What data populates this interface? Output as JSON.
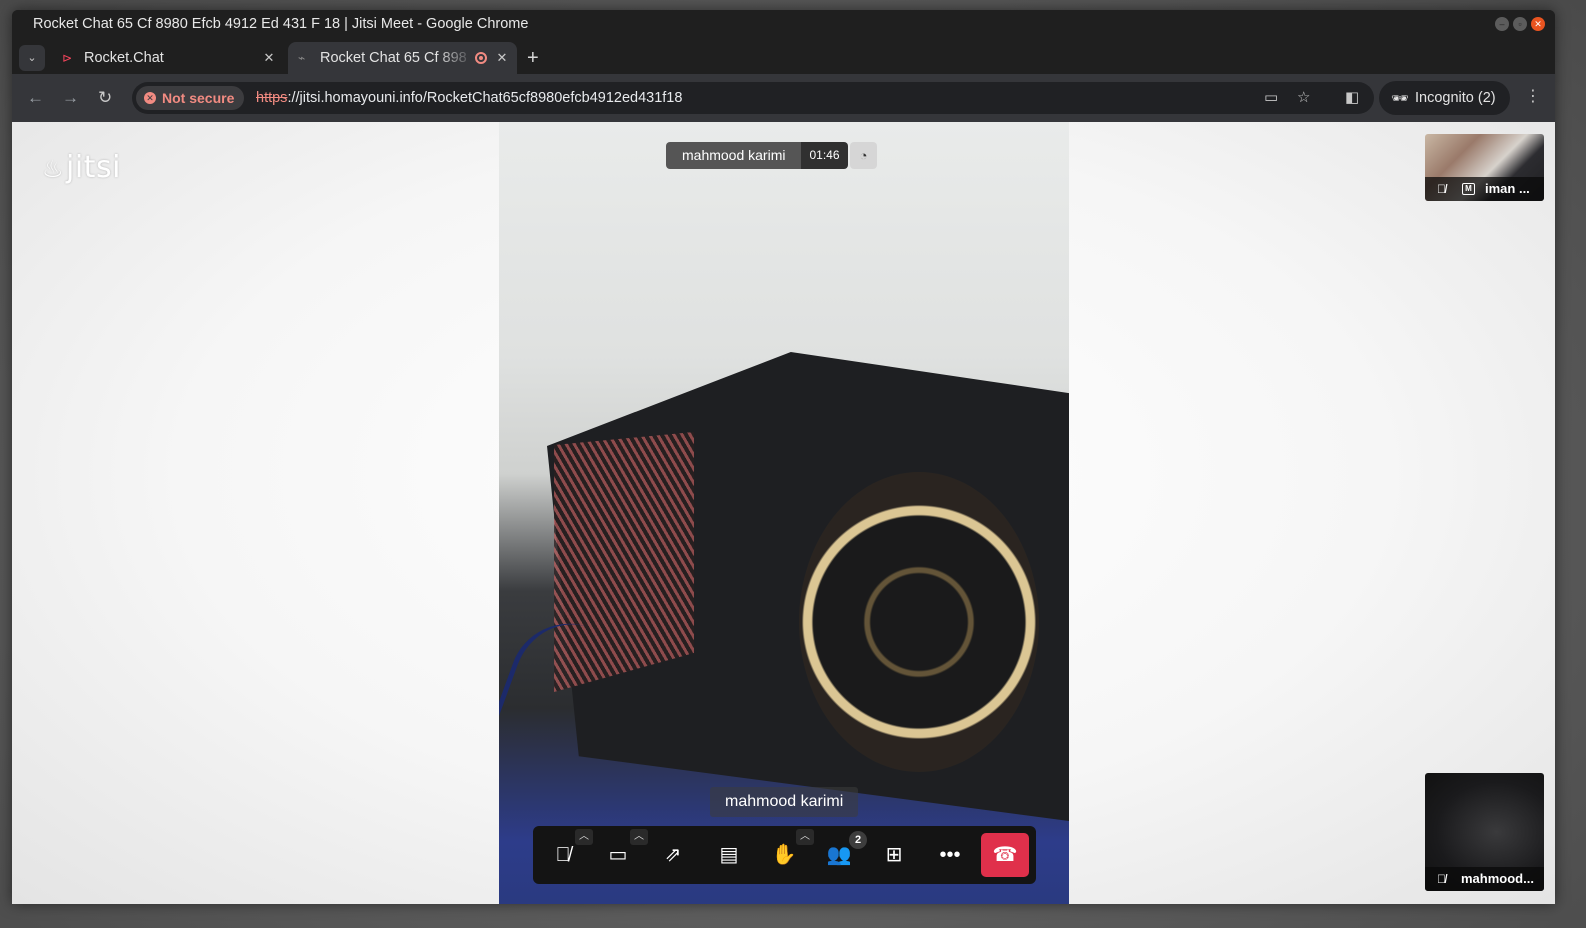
{
  "window": {
    "title": "Rocket Chat 65 Cf 8980 Efcb 4912 Ed 431 F 18 | Jitsi Meet - Google Chrome"
  },
  "tabs": [
    {
      "title": "Rocket.Chat",
      "active": false
    },
    {
      "title": "Rocket Chat 65 Cf 898",
      "active": true,
      "recording": true
    }
  ],
  "toolbar": {
    "security_label": "Not secure",
    "url_scheme": "https",
    "url_rest": "://jitsi.homayouni.info/RocketChat65cf8980efcb4912ed431f18",
    "incognito_label": "Incognito (2)"
  },
  "meeting": {
    "logo": "jitsi",
    "speaker_name": "mahmood karimi",
    "timer": "01:46",
    "subtitle_name": "mahmood karimi",
    "participants_count": "2",
    "accent_hangup": "#e0304b"
  },
  "thumbnails": [
    {
      "name": "iman ...",
      "muted": true,
      "moderator": true,
      "moderator_badge": "M"
    },
    {
      "name": "mahmood...",
      "muted": true,
      "moderator": false
    }
  ],
  "icons": {
    "mic": "mic-muted-icon",
    "camera": "camera-icon",
    "share": "screen-share-icon",
    "chat": "chat-icon",
    "hand": "raise-hand-icon",
    "participants": "participants-icon",
    "tile": "tile-view-icon",
    "more": "more-icon",
    "hangup": "hangup-icon"
  }
}
